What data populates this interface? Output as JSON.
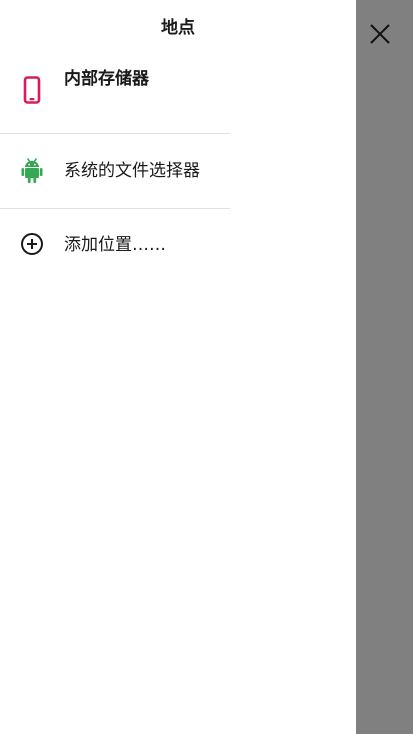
{
  "header": {
    "title": "地点",
    "close_icon": "close-icon"
  },
  "locations": {
    "items": [
      {
        "label": "内部存储器",
        "icon": "phone-icon",
        "icon_color": "#d81b60"
      },
      {
        "label": "系统的文件选择器",
        "icon": "android-icon",
        "icon_color": "#34a853"
      },
      {
        "label": "添加位置……",
        "icon": "add-circle-icon",
        "icon_color": "#1a1a1a"
      }
    ]
  },
  "colors": {
    "scrim": "#808080",
    "divider": "#e0e0e0",
    "text": "#1a1a1a"
  }
}
